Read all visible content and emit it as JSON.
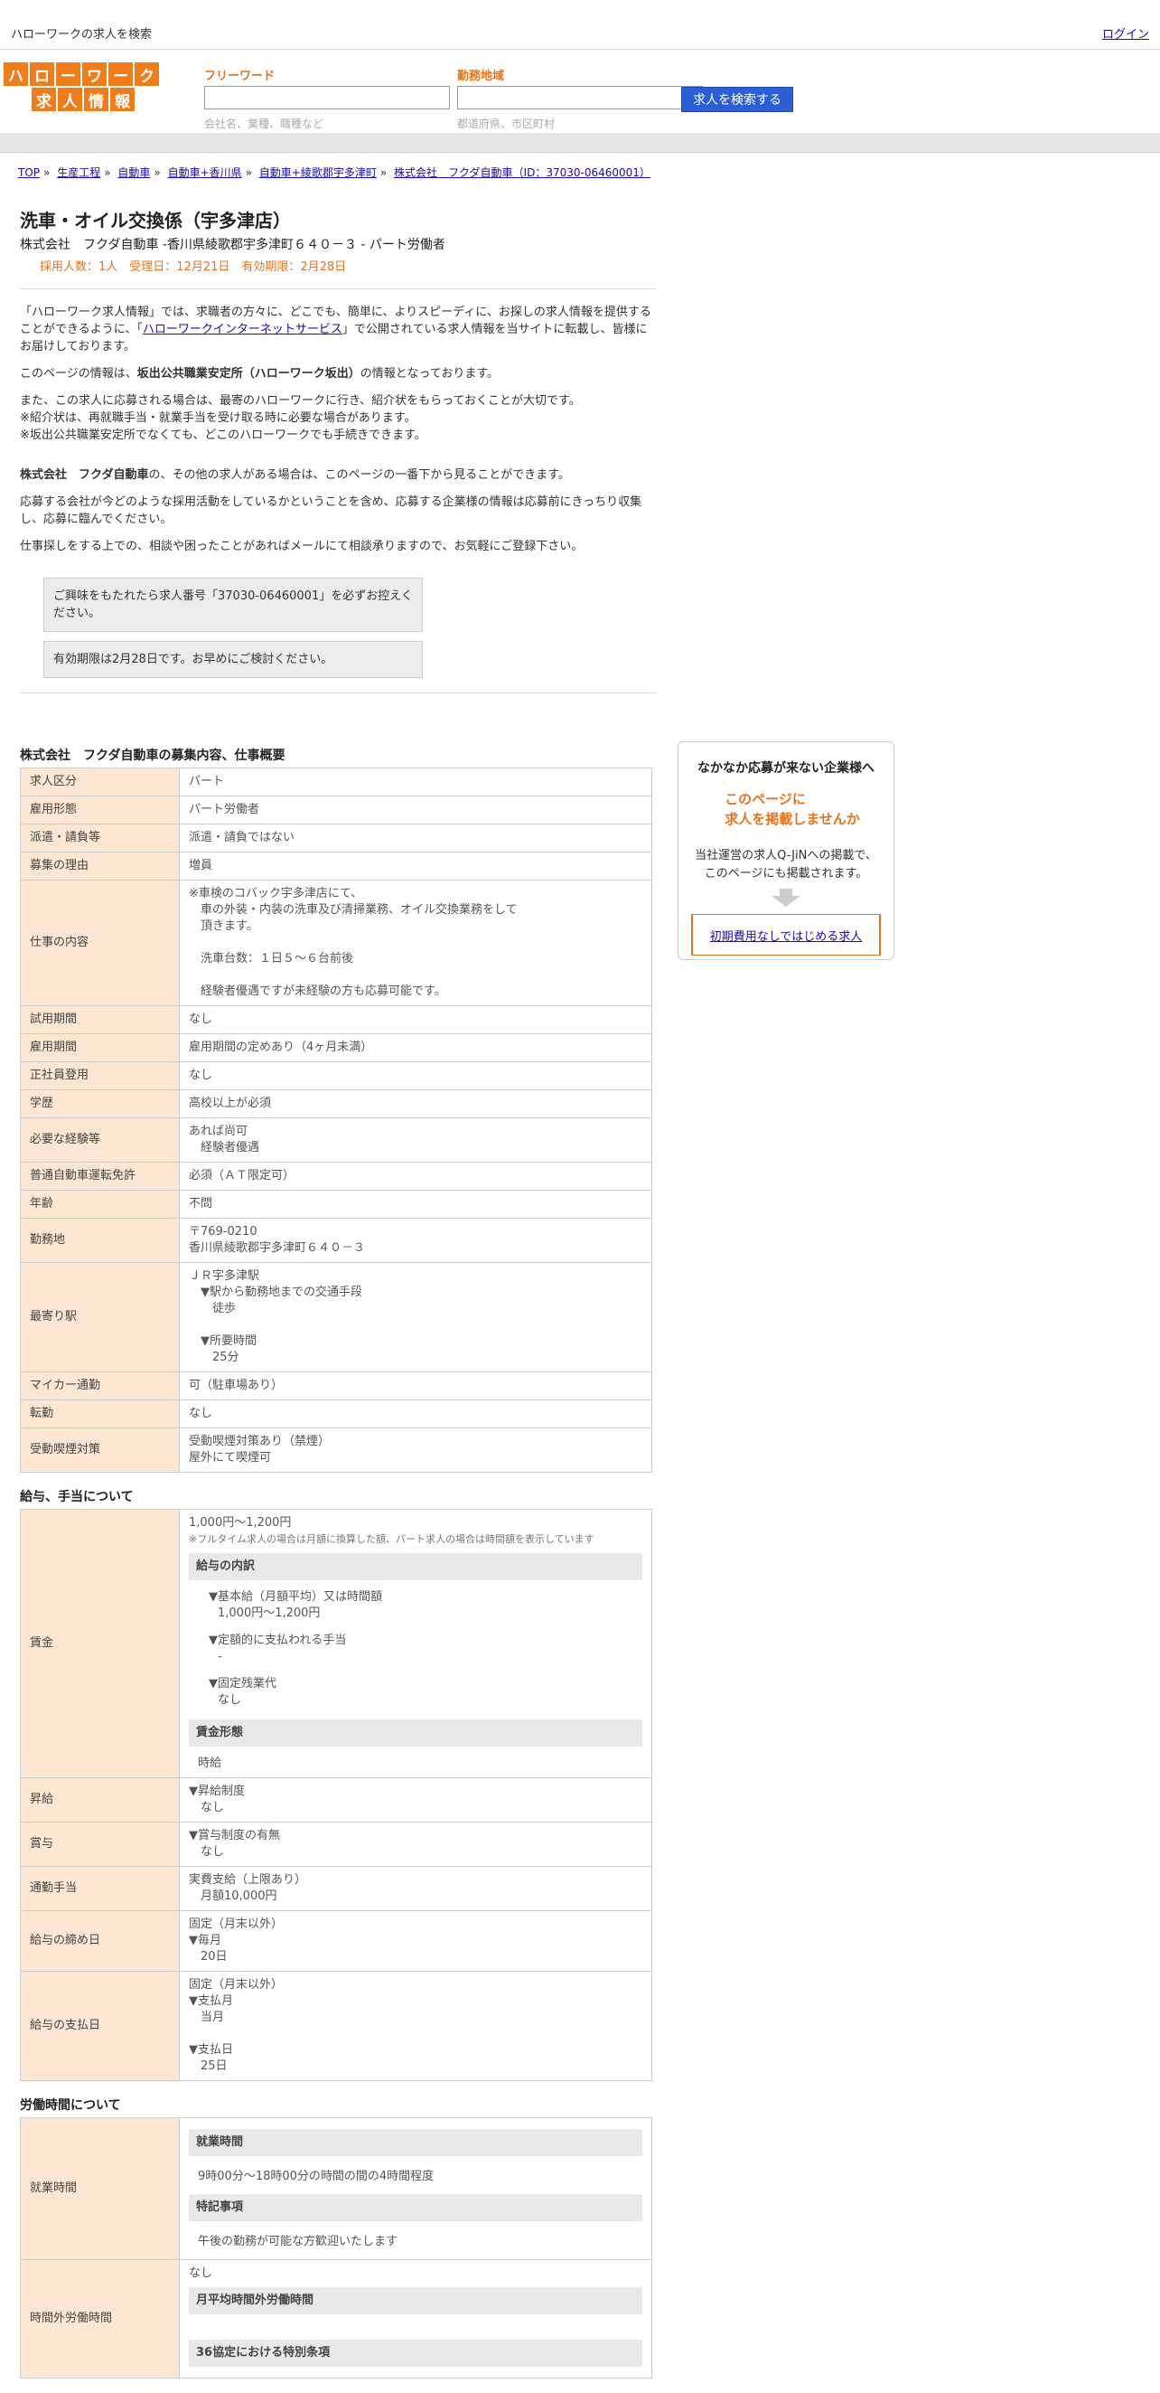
{
  "topbar": {
    "site_title": "ハローワークの求人を検索",
    "login": "ログイン"
  },
  "logo": {
    "row1": [
      "ハ",
      "ロ",
      "ー",
      "ワ",
      "ー",
      "ク"
    ],
    "row2": [
      "求",
      "人",
      "情",
      "報"
    ]
  },
  "search": {
    "keyword_label": "フリーワード",
    "keyword_placeholder": "会社名、業種、職種など",
    "area_label": "勤務地域",
    "area_placeholder": "都道府県、市区町村",
    "button": "求人を検索する"
  },
  "breadcrumb": [
    "TOP",
    "生産工程",
    "自動車",
    "自動車+香川県",
    "自動車+綾歌郡宇多津町",
    "株式会社　フクダ自動車（ID：37030-06460001）"
  ],
  "job": {
    "title": "洗車・オイル交換係（宇多津店）",
    "subline": "株式会社　フクダ自動車 -香川県綾歌郡宇多津町６４０－３ - パート労働者",
    "meta": "採用人数：1人　受理日：12月21日　有効期限：2月28日"
  },
  "intro": {
    "p1a": "「ハローワーク求人情報」では、求職者の方々に、どこでも、簡単に、よりスピーディに、お探しの求人情報を提供することができるように、「",
    "p1link": "ハローワークインターネットサービス",
    "p1b": "」で公開されている求人情報を当サイトに転載し、皆様にお届けしております。",
    "p2a": "このページの情報は、",
    "p2b": "坂出公共職業安定所（ハローワーク坂出）",
    "p2c": "の情報となっております。",
    "p3l1": "また、この求人に応募される場合は、最寄のハローワークに行き、紹介状をもらっておくことが大切です。",
    "p3l2": "※紹介状は、再就職手当・就業手当を受け取る時に必要な場合があります。",
    "p3l3": "※坂出公共職業安定所でなくても、どこのハローワークでも手続きできます。",
    "p4a": "株式会社　フクダ自動車",
    "p4b": "の、その他の求人がある場合は、このページの一番下から見ることができます。",
    "p5": "応募する会社が今どのような採用活動をしているかということを含め、応募する企業様の情報は応募前にきっちり収集し、応募に臨んでください。",
    "p6": "仕事探しをする上での、相談や困ったことがあればメールにて相談承りますので、お気軽にご登録下さい。",
    "note1": "ご興味をもたれたら求人番号「37030-06460001」を必ずお控えください。",
    "note2": "有効期限は2月28日です。お早めにご検討ください。"
  },
  "section1": {
    "title": "株式会社　フクダ自動車の募集内容、仕事概要",
    "rows": [
      {
        "label": "求人区分",
        "lines": [
          "パート"
        ]
      },
      {
        "label": "雇用形態",
        "lines": [
          "パート労働者"
        ]
      },
      {
        "label": "派遣・請負等",
        "lines": [
          "派遣・請負ではない"
        ]
      },
      {
        "label": "募集の理由",
        "lines": [
          "増員"
        ]
      },
      {
        "label": "仕事の内容",
        "lines": [
          "※車検のコバック宇多津店にて、",
          "　車の外装・内装の洗車及び清掃業務、オイル交換業務をして",
          "　頂きます。",
          "",
          "　洗車台数：１日５～６台前後",
          "",
          "　経験者優遇ですが未経験の方も応募可能です。"
        ]
      },
      {
        "label": "試用期間",
        "lines": [
          "なし"
        ]
      },
      {
        "label": "雇用期間",
        "lines": [
          "雇用期間の定めあり（4ヶ月未満）"
        ]
      },
      {
        "label": "正社員登用",
        "lines": [
          "なし"
        ]
      },
      {
        "label": "学歴",
        "lines": [
          "高校以上が必須"
        ]
      },
      {
        "label": "必要な経験等",
        "lines": [
          "あれば尚可",
          "　経験者優遇"
        ]
      },
      {
        "label": "普通自動車運転免許",
        "lines": [
          "必須（ＡＴ限定可）"
        ]
      },
      {
        "label": "年齢",
        "lines": [
          "不問"
        ]
      },
      {
        "label": "勤務地",
        "lines": [
          "〒769-0210",
          "香川県綾歌郡宇多津町６４０－３"
        ]
      },
      {
        "label": "最寄り駅",
        "lines": [
          "ＪＲ宇多津駅",
          "　▼駅から勤務地までの交通手段",
          "　　徒歩",
          "",
          "　▼所要時間",
          "　　25分"
        ]
      },
      {
        "label": "マイカー通勤",
        "lines": [
          "可（駐車場あり）"
        ]
      },
      {
        "label": "転勤",
        "lines": [
          "なし"
        ]
      },
      {
        "label": "受動喫煙対策",
        "lines": [
          "受動喫煙対策あり（禁煙）",
          "屋外にて喫煙可"
        ]
      }
    ]
  },
  "section2": {
    "title": "給与、手当について",
    "wage_label": "賃金",
    "wage_amount": "1,000円〜1,200円",
    "wage_note": "※フルタイム求人の場合は月額に換算した額、パート求人の場合は時間額を表示しています",
    "breakdown_title": "給与の内訳",
    "b1": "▼基本給（月額平均）又は時間額",
    "b1v": "1,000円〜1,200円",
    "b2": "▼定額的に支払われる手当",
    "b2v": "-",
    "b3": "▼固定残業代",
    "b3v": "なし",
    "form_title": "賃金形態",
    "form_value": "時給",
    "rows": [
      {
        "label": "昇給",
        "lines": [
          "▼昇給制度",
          "　なし"
        ]
      },
      {
        "label": "賞与",
        "lines": [
          "▼賞与制度の有無",
          "　なし"
        ]
      },
      {
        "label": "通勤手当",
        "lines": [
          "実費支給（上限あり）",
          "　月額10,000円"
        ]
      },
      {
        "label": "給与の締め日",
        "lines": [
          "固定（月末以外）",
          "▼毎月",
          "　20日"
        ]
      },
      {
        "label": "給与の支払日",
        "lines": [
          "固定（月末以外）",
          "▼支払月",
          "　当月",
          "",
          "▼支払日",
          "　25日"
        ]
      }
    ]
  },
  "section3": {
    "title": "労働時間について",
    "hours_label": "就業時間",
    "hours_sub1": "就業時間",
    "hours_val1": "9時00分〜18時00分の時間の間の4時間程度",
    "hours_sub2": "特記事項",
    "hours_val2": "午後の勤務が可能な方歓迎いたします",
    "ot_label": "時間外労働時間",
    "ot_val": "なし",
    "ot_sub1": "月平均時間外労働時間",
    "ot_sub2": "36協定における特別条項"
  },
  "sidebar": {
    "heading": "なかなか応募が来ない企業様へ",
    "offer1": "このページに",
    "offer2": "求人を掲載しませんか",
    "desc1": "当社運営の求人Q-JiNへの掲載で、",
    "desc2": "このページにも掲載されます。",
    "link": "初期費用なしではじめる求人"
  }
}
